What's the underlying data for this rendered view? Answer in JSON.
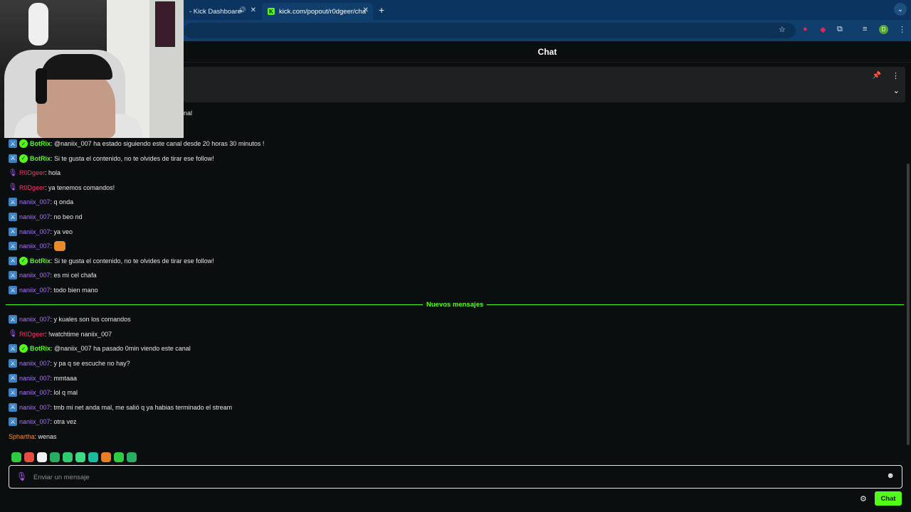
{
  "browser": {
    "tabs": [
      {
        "title": "- Kick Dashboard",
        "active": false
      },
      {
        "title": "kick.com/popout/r0dgeer/cha",
        "active": true
      }
    ],
    "new_tab_label": "+",
    "tab_menu_label": "⌄",
    "profile_initial": "D"
  },
  "chat": {
    "header_title": "Chat",
    "partial_text": "nal",
    "divider_label": "Nuevos mensajes",
    "messages": [
      {
        "user": "BotRix",
        "role": "botrix",
        "badges": [
          "mod",
          "verified"
        ],
        "text": ": @naniix_007 ha estado siguiendo este canal desde 20 horas 30 minutos !"
      },
      {
        "user": "BotRix",
        "role": "botrix",
        "badges": [
          "mod",
          "verified"
        ],
        "text": ": Si te gusta el contenido, no te olvides de tirar ese follow!"
      },
      {
        "user": "R0Dgeer",
        "role": "r0dgeer",
        "badges": [
          "mic"
        ],
        "text": ": hola"
      },
      {
        "user": "R0Dgeer",
        "role": "r0dgeer",
        "badges": [
          "mic"
        ],
        "text": ": ya tenemos comandos!"
      },
      {
        "user": "naniix_007",
        "role": "naniix",
        "badges": [
          "mod"
        ],
        "text": ": q onda"
      },
      {
        "user": "naniix_007",
        "role": "naniix",
        "badges": [
          "mod"
        ],
        "text": ": no beo nd"
      },
      {
        "user": "naniix_007",
        "role": "naniix",
        "badges": [
          "mod"
        ],
        "text": ": ya veo"
      },
      {
        "user": "naniix_007",
        "role": "naniix",
        "badges": [
          "mod"
        ],
        "text": ":",
        "emote": "dog-emote"
      },
      {
        "user": "BotRix",
        "role": "botrix",
        "badges": [
          "mod",
          "verified"
        ],
        "text": ": Si te gusta el contenido, no te olvides de tirar ese follow!"
      },
      {
        "user": "naniix_007",
        "role": "naniix",
        "badges": [
          "mod"
        ],
        "text": ": es mi cel chafa"
      },
      {
        "user": "naniix_007",
        "role": "naniix",
        "badges": [
          "mod"
        ],
        "text": ": todo bien mano"
      },
      {
        "user": "naniix_007",
        "role": "naniix",
        "badges": [
          "mod"
        ],
        "text": ": y kuales son los comandos"
      },
      {
        "user": "R0Dgeer",
        "role": "r0dgeer",
        "badges": [
          "mic"
        ],
        "text": ": !watchtime naniix_007"
      },
      {
        "user": "BotRix",
        "role": "botrix",
        "badges": [
          "mod",
          "verified"
        ],
        "text": ": @naniix_007 ha pasado 0min viendo este canal"
      },
      {
        "user": "naniix_007",
        "role": "naniix",
        "badges": [
          "mod"
        ],
        "text": ": y pa q se escuche no hay?"
      },
      {
        "user": "naniix_007",
        "role": "naniix",
        "badges": [
          "mod"
        ],
        "text": ": mmtaaa"
      },
      {
        "user": "naniix_007",
        "role": "naniix",
        "badges": [
          "mod"
        ],
        "text": ": lol q mal"
      },
      {
        "user": "naniix_007",
        "role": "naniix",
        "badges": [
          "mod"
        ],
        "text": ": tmb mi net anda mal, me salió q ya habias terminado el stream"
      },
      {
        "user": "naniix_007",
        "role": "naniix",
        "badges": [
          "mod"
        ],
        "text": ": otra vez"
      },
      {
        "user": "Sphartha",
        "role": "sphartha",
        "badges": [],
        "text": ": wenas"
      }
    ],
    "input": {
      "placeholder": "Enviar un mensaje",
      "value": ""
    },
    "send_button_label": "Chat",
    "emote_colors": [
      "#2ecc40",
      "#e74c3c",
      "#f0f0f0",
      "#27ae60",
      "#2ecc71",
      "#3ddc84",
      "#1abc9c",
      "#e67e22",
      "#2ecc40",
      "#27ae60"
    ]
  },
  "colors": {
    "accent": "#53fc18",
    "tabbar": "#0b3560",
    "background": "#0b0e0f",
    "botrix": "#53fc18",
    "naniix": "#a970ff",
    "r0dgeer": "#ff2d6b",
    "sphartha": "#ff8a33"
  }
}
